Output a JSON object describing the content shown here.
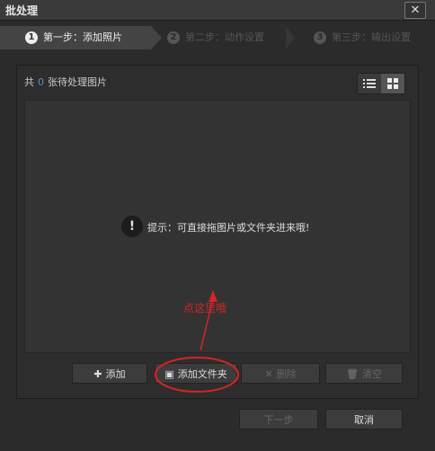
{
  "window": {
    "title": "批处理",
    "close_glyph": "✕"
  },
  "steps": [
    {
      "num": "1",
      "label": "第一步：添加照片",
      "active": true
    },
    {
      "num": "2",
      "label": "第二步：动作设置",
      "active": false
    },
    {
      "num": "3",
      "label": "第三步：输出设置",
      "active": false
    }
  ],
  "panel": {
    "count_prefix": "共",
    "count_value": "0",
    "count_suffix": "张待处理图片",
    "hint_icon": "!",
    "hint": "提示：可直接拖图片或文件夹进来哦!",
    "annotation_note": "点这里哦"
  },
  "buttons": {
    "add": "添加",
    "add_folder": "添加文件夹",
    "delete": "删除",
    "clear": "清空",
    "next": "下一步",
    "cancel": "取消"
  },
  "colors": {
    "accent": "#5a8ec4",
    "annotation": "#d42424"
  }
}
